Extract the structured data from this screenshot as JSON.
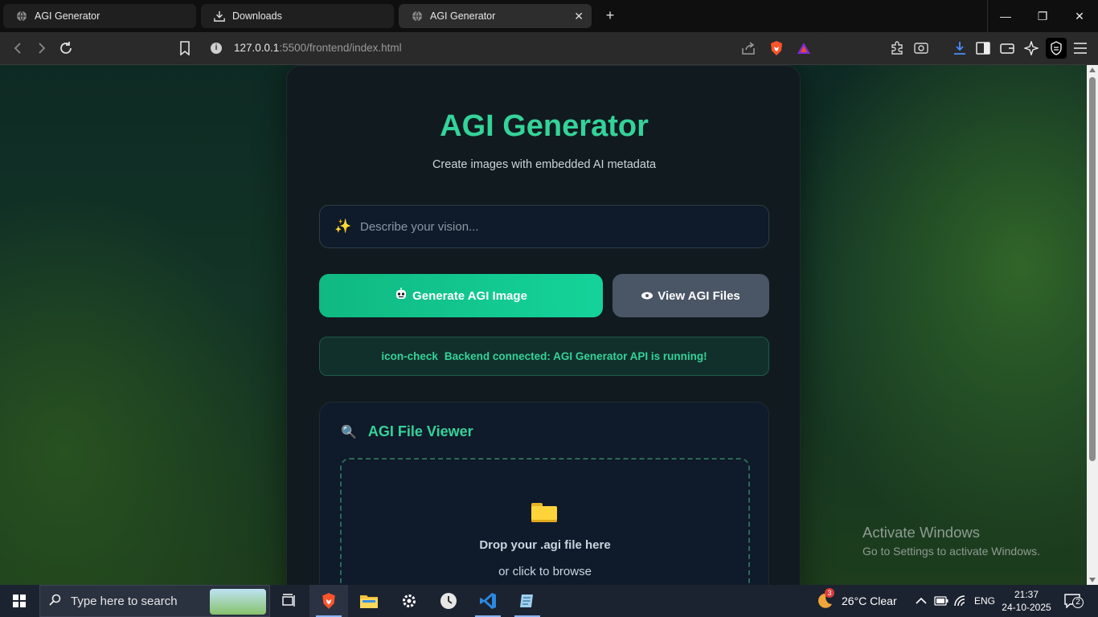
{
  "browser": {
    "tabs": [
      {
        "label": "AGI Generator",
        "icon": "globe-icon",
        "active": false
      },
      {
        "label": "Downloads",
        "icon": "download-icon",
        "active": false
      },
      {
        "label": "AGI Generator",
        "icon": "globe-icon",
        "active": true
      }
    ],
    "url_host": "127.0.0.1",
    "url_rest": ":5500/frontend/index.html"
  },
  "app": {
    "title": "AGI Generator",
    "subtitle": "Create images with embedded AI metadata",
    "prompt_placeholder": "Describe your vision...",
    "generate_label": "Generate AGI Image",
    "view_label": "View AGI Files",
    "status_icon_text": "icon-check",
    "status_text": "Backend connected: AGI Generator API is running!",
    "viewer_title": "AGI File Viewer",
    "drop_title": "Drop your .agi file here",
    "drop_sub": "or click to browse",
    "accent_color": "#34d399"
  },
  "watermark": {
    "line1": "Activate Windows",
    "line2": "Go to Settings to activate Windows."
  },
  "taskbar": {
    "search_placeholder": "Type here to search",
    "weather_badge": "3",
    "weather_text": "26°C  Clear",
    "language": "ENG",
    "time": "21:37",
    "date": "24-10-2025",
    "notification_count": "2"
  }
}
